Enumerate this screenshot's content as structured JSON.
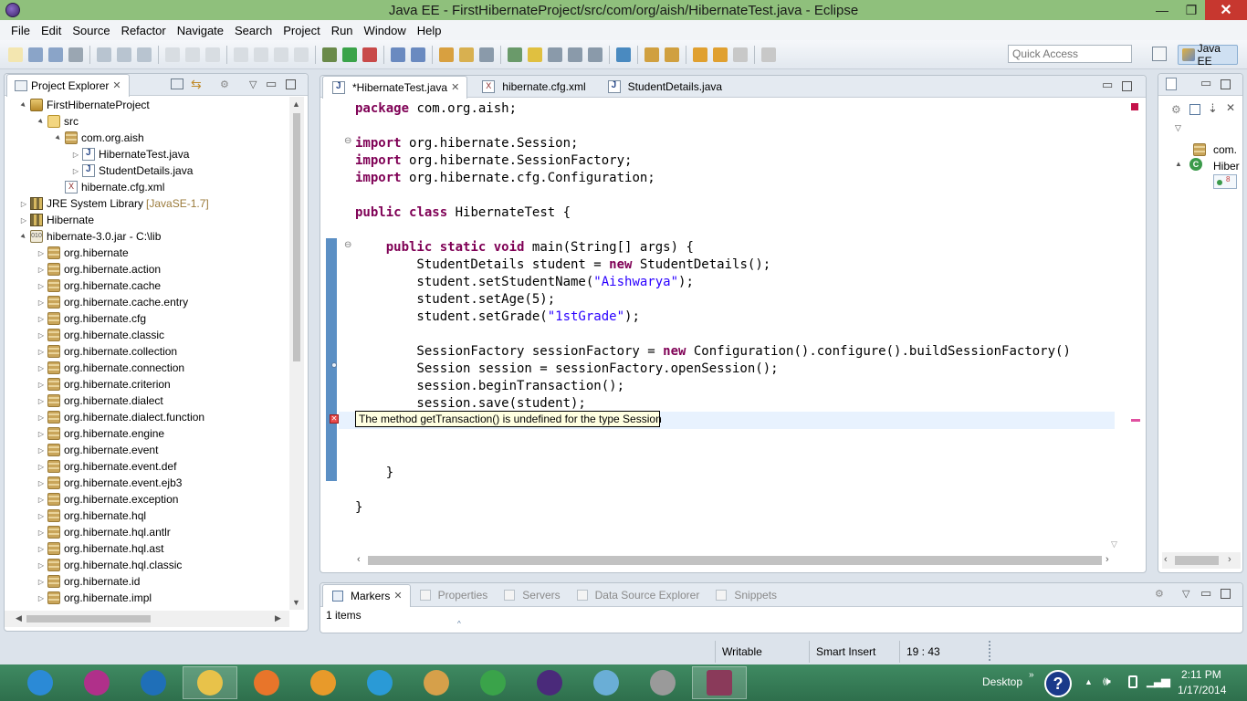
{
  "window": {
    "title": "Java EE - FirstHibernateProject/src/com/org/aish/HibernateTest.java - Eclipse",
    "minimize_glyph": "—",
    "maximize_glyph": "❐",
    "close_glyph": "✕"
  },
  "menu": [
    "File",
    "Edit",
    "Source",
    "Refactor",
    "Navigate",
    "Search",
    "Project",
    "Run",
    "Window",
    "Help"
  ],
  "quick_access": {
    "placeholder": "Quick Access"
  },
  "perspective": {
    "label": "Java EE"
  },
  "project_explorer": {
    "title": "Project Explorer",
    "close": "✕",
    "tree": [
      {
        "label": "FirstHibernateProject",
        "depth": 0,
        "twisty": "▲",
        "icon": "project-icon"
      },
      {
        "label": "src",
        "depth": 1,
        "twisty": "▲",
        "icon": "source-folder-icon"
      },
      {
        "label": "com.org.aish",
        "depth": 2,
        "twisty": "▲",
        "icon": "package-icon"
      },
      {
        "label": "HibernateTest.java",
        "depth": 3,
        "twisty": "▷",
        "icon": "java-file-icon"
      },
      {
        "label": "StudentDetails.java",
        "depth": 3,
        "twisty": "▷",
        "icon": "java-file-icon"
      },
      {
        "label": "hibernate.cfg.xml",
        "depth": 2,
        "twisty": "",
        "icon": "xml-file-icon"
      },
      {
        "label": "JRE System Library",
        "suffix": "[JavaSE-1.7]",
        "depth": 0,
        "twisty": "▷",
        "icon": "library-icon"
      },
      {
        "label": "Hibernate",
        "depth": 0,
        "twisty": "▷",
        "icon": "library-icon"
      },
      {
        "label": "hibernate-3.0.jar - C:\\lib",
        "depth": 0,
        "twisty": "▲",
        "icon": "jar-icon"
      },
      {
        "label": "org.hibernate",
        "depth": 1,
        "twisty": "▷",
        "icon": "package-icon"
      },
      {
        "label": "org.hibernate.action",
        "depth": 1,
        "twisty": "▷",
        "icon": "package-icon"
      },
      {
        "label": "org.hibernate.cache",
        "depth": 1,
        "twisty": "▷",
        "icon": "package-icon"
      },
      {
        "label": "org.hibernate.cache.entry",
        "depth": 1,
        "twisty": "▷",
        "icon": "package-icon"
      },
      {
        "label": "org.hibernate.cfg",
        "depth": 1,
        "twisty": "▷",
        "icon": "package-icon"
      },
      {
        "label": "org.hibernate.classic",
        "depth": 1,
        "twisty": "▷",
        "icon": "package-icon"
      },
      {
        "label": "org.hibernate.collection",
        "depth": 1,
        "twisty": "▷",
        "icon": "package-icon"
      },
      {
        "label": "org.hibernate.connection",
        "depth": 1,
        "twisty": "▷",
        "icon": "package-icon"
      },
      {
        "label": "org.hibernate.criterion",
        "depth": 1,
        "twisty": "▷",
        "icon": "package-icon"
      },
      {
        "label": "org.hibernate.dialect",
        "depth": 1,
        "twisty": "▷",
        "icon": "package-icon"
      },
      {
        "label": "org.hibernate.dialect.function",
        "depth": 1,
        "twisty": "▷",
        "icon": "package-icon"
      },
      {
        "label": "org.hibernate.engine",
        "depth": 1,
        "twisty": "▷",
        "icon": "package-icon"
      },
      {
        "label": "org.hibernate.event",
        "depth": 1,
        "twisty": "▷",
        "icon": "package-icon"
      },
      {
        "label": "org.hibernate.event.def",
        "depth": 1,
        "twisty": "▷",
        "icon": "package-icon"
      },
      {
        "label": "org.hibernate.event.ejb3",
        "depth": 1,
        "twisty": "▷",
        "icon": "package-icon"
      },
      {
        "label": "org.hibernate.exception",
        "depth": 1,
        "twisty": "▷",
        "icon": "package-icon"
      },
      {
        "label": "org.hibernate.hql",
        "depth": 1,
        "twisty": "▷",
        "icon": "package-icon"
      },
      {
        "label": "org.hibernate.hql.antlr",
        "depth": 1,
        "twisty": "▷",
        "icon": "package-icon"
      },
      {
        "label": "org.hibernate.hql.ast",
        "depth": 1,
        "twisty": "▷",
        "icon": "package-icon"
      },
      {
        "label": "org.hibernate.hql.classic",
        "depth": 1,
        "twisty": "▷",
        "icon": "package-icon"
      },
      {
        "label": "org.hibernate.id",
        "depth": 1,
        "twisty": "▷",
        "icon": "package-icon"
      },
      {
        "label": "org.hibernate.impl",
        "depth": 1,
        "twisty": "▷",
        "icon": "package-icon"
      }
    ]
  },
  "editor": {
    "tabs": [
      {
        "label": "*HibernateTest.java",
        "active": true,
        "close": "✕",
        "icon": "java-file-icon"
      },
      {
        "label": "hibernate.cfg.xml",
        "active": false,
        "icon": "xml-file-icon"
      },
      {
        "label": "StudentDetails.java",
        "active": false,
        "icon": "java-file-icon"
      }
    ],
    "lines": [
      [
        {
          "t": "package",
          "k": 1
        },
        {
          "t": " com.org.aish;"
        }
      ],
      [],
      [
        {
          "t": "import",
          "k": 1
        },
        {
          "t": " org.hibernate.Session;"
        }
      ],
      [
        {
          "t": "import",
          "k": 1
        },
        {
          "t": " org.hibernate.SessionFactory;"
        }
      ],
      [
        {
          "t": "import",
          "k": 1
        },
        {
          "t": " org.hibernate.cfg.Configuration;"
        }
      ],
      [],
      [
        {
          "t": "public",
          "k": 1
        },
        {
          "t": " "
        },
        {
          "t": "class",
          "k": 1
        },
        {
          "t": " HibernateTest {"
        }
      ],
      [],
      [
        {
          "t": "    "
        },
        {
          "t": "public",
          "k": 1
        },
        {
          "t": " "
        },
        {
          "t": "static",
          "k": 1
        },
        {
          "t": " "
        },
        {
          "t": "void",
          "k": 1
        },
        {
          "t": " main(String[] args) {"
        }
      ],
      [
        {
          "t": "        StudentDetails student = "
        },
        {
          "t": "new",
          "k": 1
        },
        {
          "t": " StudentDetails();"
        }
      ],
      [
        {
          "t": "        student.setStudentName("
        },
        {
          "t": "\"Aishwarya\"",
          "s": 1
        },
        {
          "t": ");"
        }
      ],
      [
        {
          "t": "        student.setAge(5);"
        }
      ],
      [
        {
          "t": "        student.setGrade("
        },
        {
          "t": "\"1stGrade\"",
          "s": 1
        },
        {
          "t": ");"
        }
      ],
      [],
      [
        {
          "t": "        SessionFactory sessionFactory = "
        },
        {
          "t": "new",
          "k": 1
        },
        {
          "t": " Configuration().configure().buildSessionFactory()"
        }
      ],
      [
        {
          "t": "        Session session = sessionFactory.openSession();"
        }
      ],
      [
        {
          "t": "        session.beginTransaction();"
        }
      ],
      [
        {
          "t": "        session.save(student);"
        }
      ],
      [
        {
          "t": "                           it();"
        }
      ],
      [],
      [],
      [
        {
          "t": "    }"
        }
      ],
      [],
      [
        {
          "t": "}"
        }
      ]
    ],
    "tooltip": "The method getTransaction() is undefined for the type Session"
  },
  "outline": {
    "items": [
      "com.",
      "Hiber"
    ],
    "badge": "8"
  },
  "bottom": {
    "tabs": [
      {
        "label": "Markers",
        "active": true,
        "close": "✕"
      },
      {
        "label": "Properties",
        "active": false
      },
      {
        "label": "Servers",
        "active": false
      },
      {
        "label": "Data Source Explorer",
        "active": false
      },
      {
        "label": "Snippets",
        "active": false
      }
    ],
    "summary": "1 items"
  },
  "status": {
    "writable": "Writable",
    "insert_mode": "Smart Insert",
    "position": "19 : 43"
  },
  "taskbar": {
    "desktop": "Desktop",
    "time": "2:11 PM",
    "date": "1/17/2014",
    "apps": [
      {
        "name": "internet-explorer-icon",
        "color": "#2b8ad6"
      },
      {
        "name": "remote-app-icon",
        "color": "#b0308a"
      },
      {
        "name": "hp-icon",
        "color": "#1f6fb8"
      },
      {
        "name": "file-explorer-icon",
        "color": "#e8c24a"
      },
      {
        "name": "firefox-icon",
        "color": "#e8752a"
      },
      {
        "name": "media-player-icon",
        "color": "#e89a2a"
      },
      {
        "name": "rocket-icon",
        "color": "#2a9ad6"
      },
      {
        "name": "paint-icon",
        "color": "#d6a04a"
      },
      {
        "name": "chrome-icon",
        "color": "#3aa34a"
      },
      {
        "name": "eclipse-icon",
        "color": "#4a2a7a"
      },
      {
        "name": "notepad-icon",
        "color": "#6aaed6"
      },
      {
        "name": "speaker-app-icon",
        "color": "#9a9a9a"
      },
      {
        "name": "javaee-ide-icon",
        "color": "#8a3a5a"
      }
    ]
  }
}
